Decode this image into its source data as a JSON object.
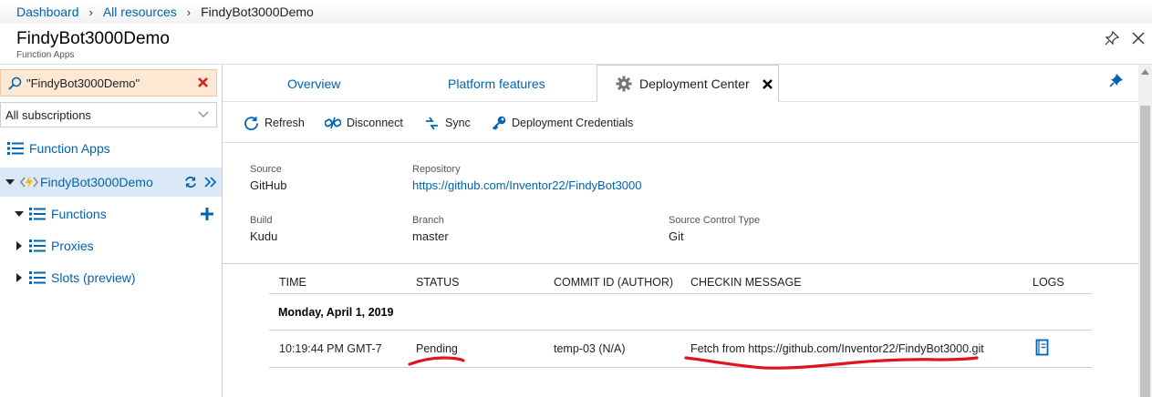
{
  "breadcrumb": {
    "items": [
      "Dashboard",
      "All resources"
    ],
    "current": "FindyBot3000Demo"
  },
  "header": {
    "title": "FindyBot3000Demo",
    "subtitle": "Function Apps"
  },
  "sidebar": {
    "search_value": "\"FindyBot3000Demo\"",
    "subscriptions": "All subscriptions",
    "function_apps": "Function Apps",
    "app_name": "FindyBot3000Demo",
    "functions": "Functions",
    "proxies": "Proxies",
    "slots": "Slots (preview)"
  },
  "tabs": {
    "overview": "Overview",
    "platform": "Platform features",
    "deployment": "Deployment Center"
  },
  "toolbar": {
    "refresh": "Refresh",
    "disconnect": "Disconnect",
    "sync": "Sync",
    "credentials": "Deployment Credentials"
  },
  "info": {
    "source_label": "Source",
    "source_value": "GitHub",
    "repo_label": "Repository",
    "repo_value": "https://github.com/Inventor22/FindyBot3000",
    "build_label": "Build",
    "build_value": "Kudu",
    "branch_label": "Branch",
    "branch_value": "master",
    "sct_label": "Source Control Type",
    "sct_value": "Git"
  },
  "table": {
    "headers": {
      "time": "TIME",
      "status": "STATUS",
      "commit": "COMMIT ID (AUTHOR)",
      "message": "CHECKIN MESSAGE",
      "logs": "LOGS"
    },
    "group": "Monday, April 1, 2019",
    "row": {
      "time": "10:19:44 PM GMT-7",
      "status": "Pending",
      "commit": "temp-03 (N/A)",
      "message": "Fetch from https://github.com/Inventor22/FindyBot3000.git"
    }
  },
  "colors": {
    "link": "#0063b1",
    "annotation": "#e0141e",
    "search_bg": "#fde8d3",
    "selected_bg": "#dbe9f7"
  }
}
